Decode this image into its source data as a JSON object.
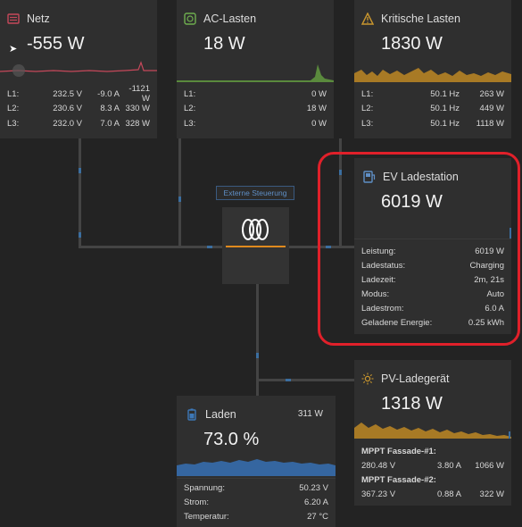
{
  "grid": {
    "header": [
      "L1:",
      "L2:",
      "L3:"
    ]
  },
  "netz": {
    "title": "Netz",
    "value": "-555 W",
    "rows": [
      {
        "label": "L1:",
        "v": "232.5 V",
        "a": "-9.0 A",
        "w": "-1121 W"
      },
      {
        "label": "L2:",
        "v": "230.6 V",
        "a": "8.3 A",
        "w": "330 W"
      },
      {
        "label": "L3:",
        "v": "232.0 V",
        "a": "7.0 A",
        "w": "328 W"
      }
    ],
    "color": "#c5485a"
  },
  "ac": {
    "title": "AC-Lasten",
    "value": "18 W",
    "rows": [
      {
        "label": "L1:",
        "w": "0 W"
      },
      {
        "label": "L2:",
        "w": "18 W"
      },
      {
        "label": "L3:",
        "w": "0 W"
      }
    ],
    "color": "#6fae4f"
  },
  "krit": {
    "title": "Kritische Lasten",
    "value": "1830 W",
    "rows": [
      {
        "label": "L1:",
        "hz": "50.1 Hz",
        "w": "263 W"
      },
      {
        "label": "L2:",
        "hz": "50.1 Hz",
        "w": "449 W"
      },
      {
        "label": "L3:",
        "hz": "50.1 Hz",
        "w": "1118 W"
      }
    ],
    "color": "#c8962e"
  },
  "inverter": {
    "tag": "Externe Steuerung"
  },
  "ev": {
    "title": "EV Ladestation",
    "value": "6019 W",
    "details": [
      {
        "k": "Leistung:",
        "v": "6019 W"
      },
      {
        "k": "Ladestatus:",
        "v": "Charging"
      },
      {
        "k": "Ladezeit:",
        "v": "2m, 21s"
      },
      {
        "k": "Modus:",
        "v": "Auto"
      },
      {
        "k": "Ladestrom:",
        "v": "6.0 A"
      },
      {
        "k": "Geladene Energie:",
        "v": "0.25 kWh"
      }
    ],
    "highlight": "#e0202a"
  },
  "battery": {
    "title": "Laden",
    "power": "311 W",
    "value": "73.0 %",
    "details": [
      {
        "k": "Spannung:",
        "v": "50.23 V"
      },
      {
        "k": "Strom:",
        "v": "6.20 A"
      },
      {
        "k": "Temperatur:",
        "v": "27 °C"
      }
    ],
    "color": "#3d78b8"
  },
  "pv": {
    "title": "PV-Ladegerät",
    "value": "1318 W",
    "mppt": [
      {
        "name": "MPPT Fassade-#1:",
        "v": "280.48 V",
        "a": "3.80 A",
        "w": "1066 W"
      },
      {
        "name": "MPPT Fassade-#2:",
        "v": "367.23 V",
        "a": "0.88 A",
        "w": "322 W"
      }
    ],
    "color": "#c8962e"
  }
}
